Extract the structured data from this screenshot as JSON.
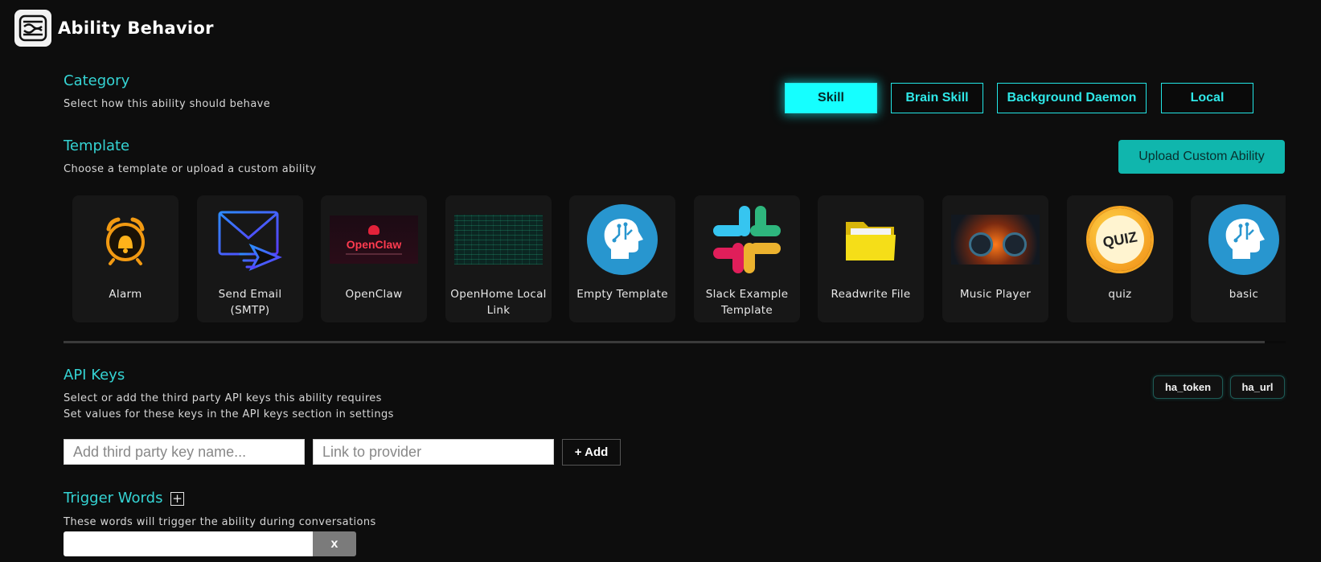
{
  "app": {
    "title": "Ability Behavior"
  },
  "category": {
    "title": "Category",
    "subtitle": "Select how this ability should behave",
    "options": [
      "Skill",
      "Brain Skill",
      "Background Daemon",
      "Local"
    ],
    "selected": "Skill"
  },
  "template": {
    "title": "Template",
    "subtitle": "Choose a template or upload a custom ability",
    "upload_label": "Upload Custom Ability",
    "cards": [
      {
        "label": "Alarm",
        "icon": "alarm-clock-icon"
      },
      {
        "label": "Send Email (SMTP)",
        "icon": "email-send-icon"
      },
      {
        "label": "OpenClaw",
        "icon": "openclaw-banner",
        "banner_text": "OpenClaw"
      },
      {
        "label": "OpenHome Local Link",
        "icon": "matrix-code-image"
      },
      {
        "label": "Empty Template",
        "icon": "ai-head-icon"
      },
      {
        "label": "Slack Example Template",
        "icon": "slack-logo-icon"
      },
      {
        "label": "Readwrite File",
        "icon": "folder-icon"
      },
      {
        "label": "Music Player",
        "icon": "headphones-image"
      },
      {
        "label": "quiz",
        "icon": "quiz-badge-icon",
        "badge_text": "QUIZ"
      },
      {
        "label": "basic",
        "icon": "ai-head-icon"
      }
    ]
  },
  "api_keys": {
    "title": "API Keys",
    "subtitle_1": "Select or add the third party API keys this ability requires",
    "subtitle_2": "Set values for these keys in the API keys section in settings",
    "tags": [
      "ha_token",
      "ha_url"
    ],
    "key_name_placeholder": "Add third party key name...",
    "provider_placeholder": "Link to provider",
    "add_label": "+ Add"
  },
  "trigger_words": {
    "title": "Trigger Words",
    "add_symbol": "+",
    "subtitle": "These words will trigger the ability during conversations",
    "value": "",
    "remove_label": "x"
  },
  "colors": {
    "accent": "#15ffff",
    "teal_button": "#10b6ad",
    "background": "#0d0d0d",
    "card": "#171717"
  }
}
